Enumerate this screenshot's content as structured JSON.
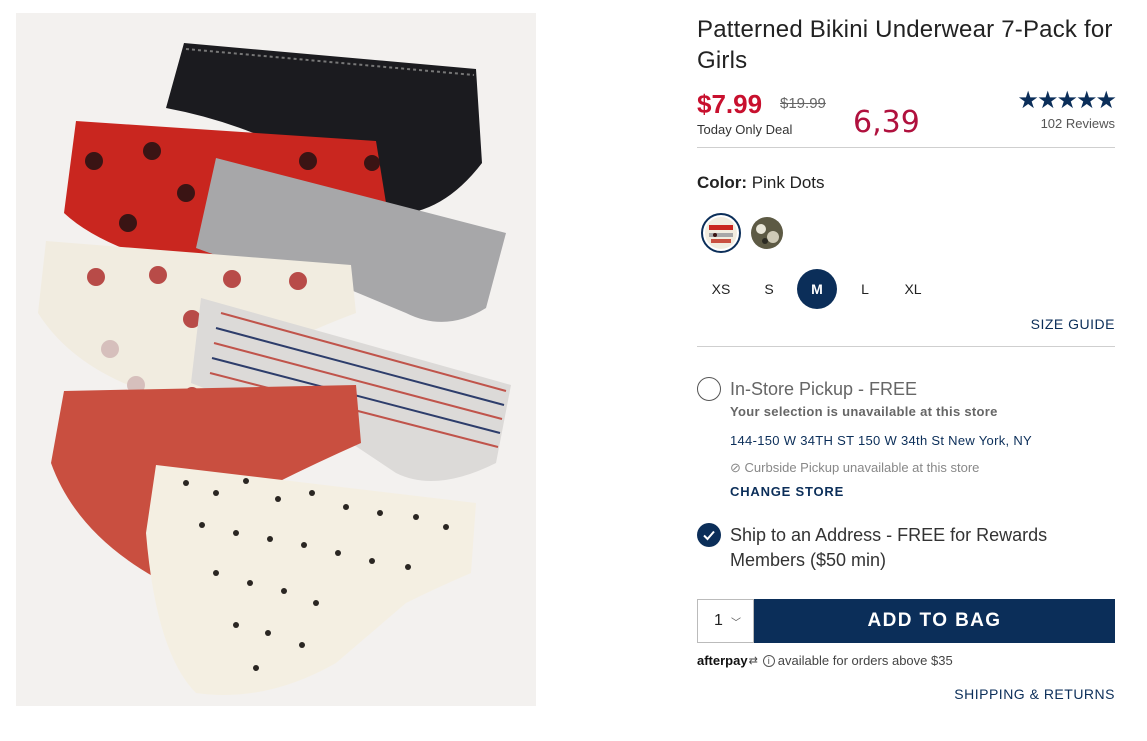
{
  "product": {
    "title": "Patterned Bikini Underwear 7-Pack for Girls",
    "image_alt": "Seven pairs of patterned bikini underwear fanned out"
  },
  "pricing": {
    "sale_price": "$7.99",
    "original_price": "$19.99",
    "deal_label": "Today Only Deal",
    "annotation": "6,39"
  },
  "rating": {
    "stars": "★★★★★",
    "reviews": "102 Reviews",
    "value_out_of_5": 5
  },
  "color": {
    "label": "Color:",
    "value": "Pink Dots",
    "swatches": [
      "pink-dots",
      "print"
    ]
  },
  "sizes": {
    "options": [
      "XS",
      "S",
      "M",
      "L",
      "XL"
    ],
    "selected": "M",
    "guide_label": "SIZE GUIDE"
  },
  "pickup": {
    "title": "In-Store Pickup - FREE",
    "note": "Your selection is unavailable at this store",
    "store_address": "144-150 W 34TH ST 150 W 34th St New York, NY",
    "curbside": "Curbside Pickup unavailable at this store",
    "change_store": "CHANGE STORE"
  },
  "shipping": {
    "option": "Ship to an Address - FREE for Rewards Members ($50 min)"
  },
  "bag": {
    "quantity": "1",
    "add_label": "ADD TO BAG"
  },
  "afterpay": {
    "logo": "afterpay",
    "text": "available for orders above $35"
  },
  "footer": {
    "shipping_returns": "SHIPPING & RETURNS"
  },
  "colors": {
    "navy": "#0b2e59",
    "sale_red": "#c8102e",
    "annotation": "#b0113e"
  }
}
